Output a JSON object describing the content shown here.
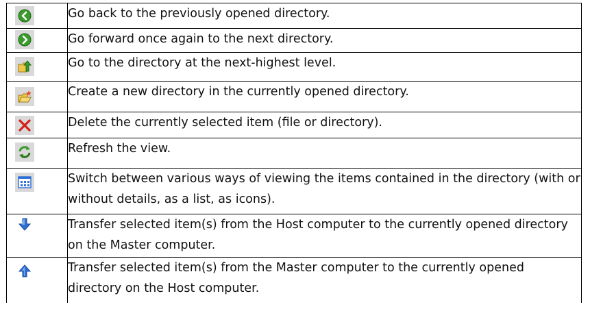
{
  "rows": [
    {
      "icon": "back-arrow-icon",
      "text": "Go back to the previously opened directory."
    },
    {
      "icon": "forward-arrow-icon",
      "text": "Go forward once again to the next directory."
    },
    {
      "icon": "folder-up-icon",
      "text": "Go to the directory at the next-highest level."
    },
    {
      "icon": "new-folder-icon",
      "text": "Create a new directory in the currently opened directory."
    },
    {
      "icon": "delete-icon",
      "text": "Delete the currently selected item (file or directory)."
    },
    {
      "icon": "refresh-icon",
      "text": "Refresh the view."
    },
    {
      "icon": "view-mode-icon",
      "text": "Switch between various ways of viewing the items contained in the directory (with or without details, as a list, as icons)."
    },
    {
      "icon": "transfer-down-icon",
      "text": "Transfer selected item(s) from the Host computer to the currently opened directory on the Master computer."
    },
    {
      "icon": "transfer-up-icon",
      "text": "Transfer selected item(s) from the Master computer to the currently opened directory on the Host computer."
    }
  ],
  "colors": {
    "icon_background": "#d9d9d9",
    "green": "#3a9a2a",
    "red": "#d4201c",
    "blue": "#2e6fd6",
    "folder": "#f0c74a"
  }
}
